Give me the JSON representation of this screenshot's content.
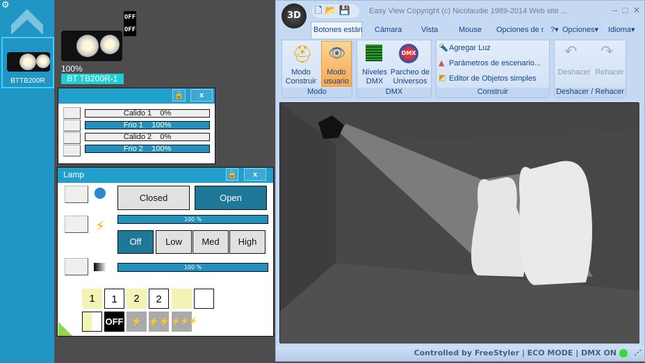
{
  "sidebar": {
    "fixture_label": "BTTB200R",
    "icons": [
      "gear-icon",
      "chevron-up-icon"
    ]
  },
  "fixture": {
    "off1": "OFF",
    "off2": "OFF",
    "intensity": "100%",
    "name": "BT TB200R-1"
  },
  "channel_panel": {
    "rows": [
      {
        "label": "Calido 1    0%",
        "value": 0
      },
      {
        "label": "Frio 1    100%",
        "value": 100
      },
      {
        "label": "Calido 2    0%",
        "value": 0
      },
      {
        "label": "Frio 2    100%",
        "value": 100
      }
    ],
    "close": "x"
  },
  "lamp_panel": {
    "title": "Lamp",
    "close": "x",
    "shutter": {
      "closed": "Closed",
      "open": "Open",
      "selected": "Open"
    },
    "strobe_bar": "100 %",
    "strobe_value": 100,
    "strobe_options": [
      "Off",
      "Low",
      "Med",
      "High"
    ],
    "strobe_selected": "Off",
    "dimmer_bar": "100 %",
    "dimmer_value": 100,
    "presets": [
      "1",
      "1",
      "2",
      "2",
      "",
      ""
    ],
    "bottom": {
      "off": "OFF"
    }
  },
  "window": {
    "title": "Easy View   Copyright (c) Nicolaudie 1989-2014   Web site ...",
    "logo": "3D",
    "tabs": [
      "Botones están",
      "Cámara",
      "Vista",
      "Mouse",
      "Opciones de r"
    ],
    "active_tab": "Botones están",
    "menus": [
      "?",
      "Opciones",
      "Idioma"
    ],
    "groups": {
      "modo": {
        "label": "Modo",
        "buttons": [
          "Modo Construir",
          "Modo usuario"
        ]
      },
      "dmx": {
        "label": "DMX",
        "buttons": [
          "Niveles DMX",
          "Parcheo de Universos"
        ]
      },
      "construir": {
        "label": "Construir",
        "items": [
          "Agregar Luz",
          "Parámetros de escenario...",
          "Editor de Objetos simples"
        ]
      },
      "undo": {
        "label": "Deshacer / Rehacer",
        "buttons": [
          "Deshacer",
          "Rehacer"
        ]
      }
    },
    "status": "Controlled by FreeStyler  |  ECO MODE  |  DMX ON",
    "status_color": "#33dd33"
  }
}
